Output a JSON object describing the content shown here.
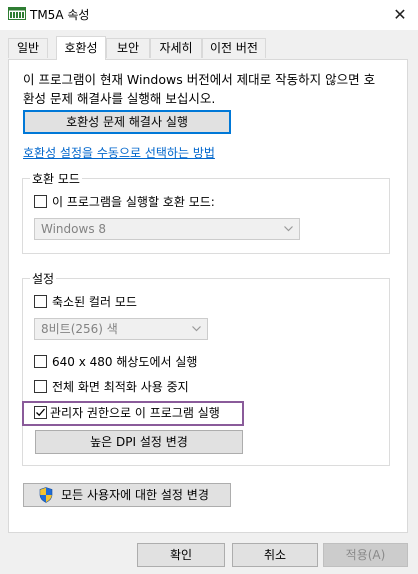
{
  "window": {
    "title": "TM5A 속성",
    "close_glyph": "✕"
  },
  "tabs": [
    {
      "label": "일반"
    },
    {
      "label": "호환성"
    },
    {
      "label": "보안"
    },
    {
      "label": "자세히"
    },
    {
      "label": "이전 버전"
    }
  ],
  "compat": {
    "intro_line1": "이 프로그램이 현재 Windows 버전에서 제대로 작동하지 않으면 호",
    "intro_line2": "환성 문제 해결사를 실행해 보십시오.",
    "troubleshooter_button": "호환성 문제 해결사 실행",
    "manual_link": "호환성 설정을 수동으로 선택하는 방법",
    "mode_group": {
      "legend": "호환 모드",
      "checkbox_label": "이 프로그램을 실행할 호환 모드:",
      "checked": false,
      "select_value": "Windows 8"
    },
    "settings_group": {
      "legend": "설정",
      "reduced_color_label": "축소된 컬러 모드",
      "reduced_color_checked": false,
      "color_select_value": "8비트(256) 색",
      "res_640_label": "640 x 480 해상도에서 실행",
      "res_640_checked": false,
      "fullscreen_label": "전체 화면 최적화 사용 중지",
      "fullscreen_checked": false,
      "admin_label": "관리자 권한으로 이 프로그램 실행",
      "admin_checked": true,
      "dpi_button": "높은 DPI 설정 변경"
    },
    "all_users_button": "모든 사용자에 대한 설정 변경"
  },
  "footer": {
    "ok": "확인",
    "cancel": "취소",
    "apply": "적용(A)"
  },
  "colors": {
    "accent": "#0078d7",
    "link": "#0066cc",
    "highlight_border": "#8a5b9a"
  },
  "icons": {
    "app": "app-window-icon",
    "check": "checkmark-icon",
    "chevron": "chevron-down-icon",
    "shield": "uac-shield-icon"
  }
}
